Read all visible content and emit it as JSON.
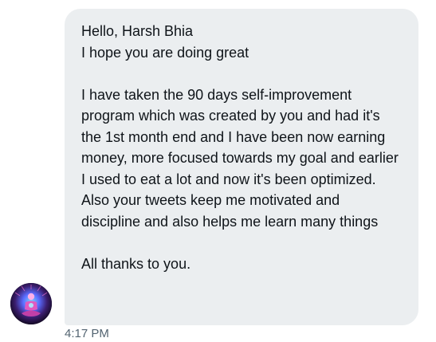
{
  "message": {
    "lines": [
      "Hello, Harsh Bhia",
      "I hope you are doing great",
      "I have taken the 90 days self-improvement program which was created by you and had it's the 1st month end and I have been now earning money, more focused towards my goal and earlier I used to eat a lot and now it's been optimized.",
      "Also your tweets keep me motivated and discipline and also helps me learn many things",
      "All thanks to you."
    ],
    "timestamp": "4:17 PM"
  },
  "colors": {
    "bubble_background": "#ebeef0",
    "text": "#0f1419",
    "timestamp": "#536471"
  },
  "sender": {
    "avatar_icon": "meditating-figure-avatar-icon"
  }
}
